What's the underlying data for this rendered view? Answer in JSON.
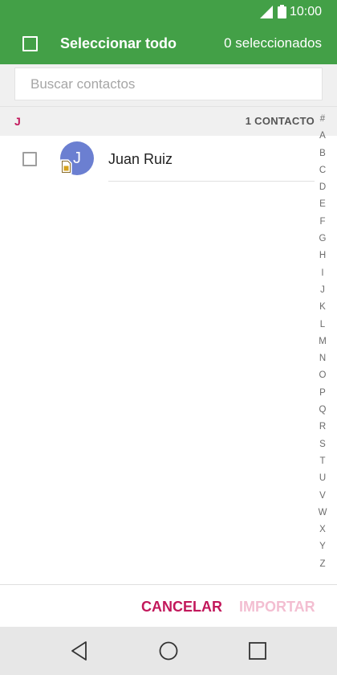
{
  "status_bar": {
    "time": "10:00",
    "signal_icon": "signal-icon",
    "battery_icon": "battery-icon"
  },
  "app_bar": {
    "select_all_label": "Seleccionar todo",
    "selected_count": "0 seleccionados"
  },
  "search": {
    "placeholder": "Buscar contactos",
    "value": ""
  },
  "section": {
    "letter": "J",
    "count_label": "1 CONTACTO"
  },
  "contacts": [
    {
      "initial": "J",
      "name": "Juan Ruiz",
      "source_icon": "sim-card-icon",
      "checked": false
    }
  ],
  "alphabet_index": [
    "#",
    "A",
    "B",
    "C",
    "D",
    "E",
    "F",
    "G",
    "H",
    "I",
    "J",
    "K",
    "L",
    "M",
    "N",
    "O",
    "P",
    "Q",
    "R",
    "S",
    "T",
    "U",
    "V",
    "W",
    "X",
    "Y",
    "Z"
  ],
  "actions": {
    "cancel_label": "CANCELAR",
    "import_label": "IMPORTAR"
  },
  "nav_bar": {
    "back_icon": "back-icon",
    "home_icon": "home-icon",
    "recents_icon": "recents-icon"
  },
  "colors": {
    "app_bar": "#43a047",
    "accent": "#c2185b",
    "accent_disabled": "#f3bed1",
    "avatar": "#6b7fd1"
  }
}
